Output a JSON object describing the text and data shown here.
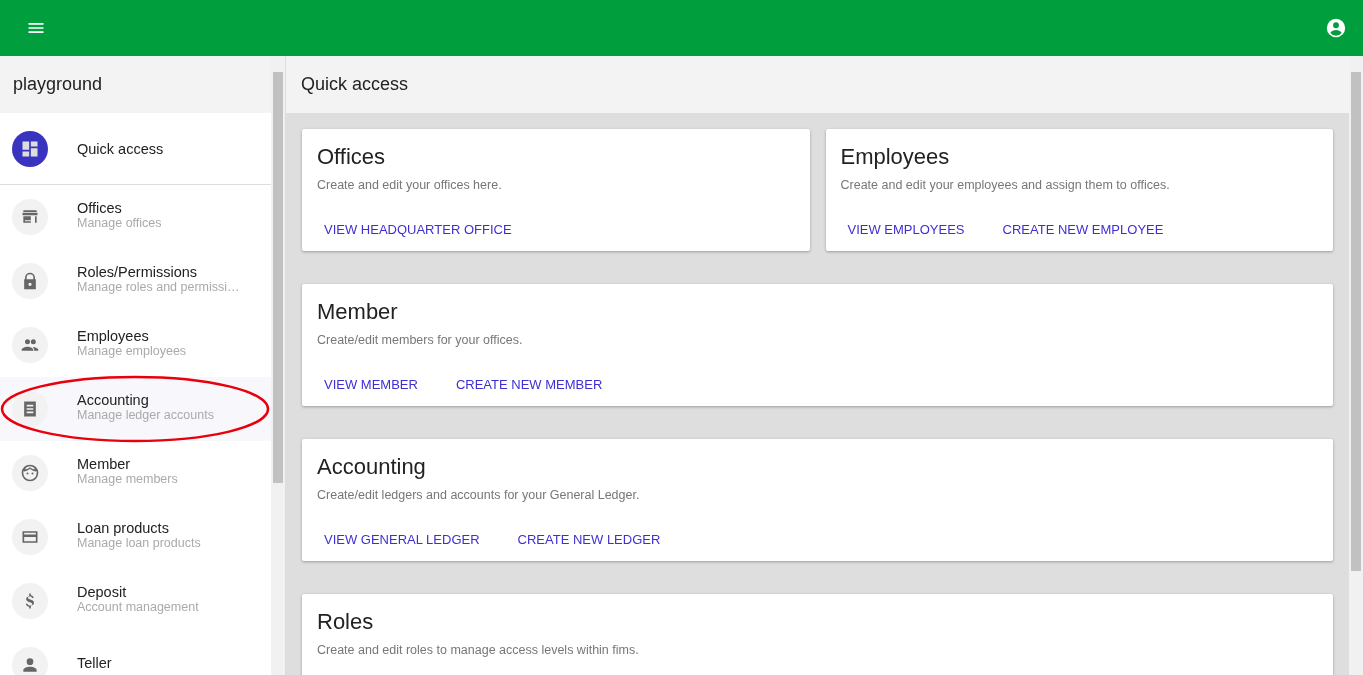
{
  "sidebar": {
    "title": "playground",
    "items": [
      {
        "kind": "primary",
        "label": "Quick access",
        "highlighted": false,
        "circled": false
      },
      {
        "kind": "entry",
        "label": "Offices",
        "sublabel": "Manage offices",
        "highlighted": false,
        "circled": false
      },
      {
        "kind": "entry",
        "label": "Roles/Permissions",
        "sublabel": "Manage roles and permissi…",
        "highlighted": false,
        "circled": false
      },
      {
        "kind": "entry",
        "label": "Employees",
        "sublabel": "Manage employees",
        "highlighted": false,
        "circled": false
      },
      {
        "kind": "entry",
        "label": "Accounting",
        "sublabel": "Manage ledger accounts",
        "highlighted": true,
        "circled": true
      },
      {
        "kind": "entry",
        "label": "Member",
        "sublabel": "Manage members",
        "highlighted": false,
        "circled": false
      },
      {
        "kind": "entry",
        "label": "Loan products",
        "sublabel": "Manage loan products",
        "highlighted": false,
        "circled": false
      },
      {
        "kind": "entry",
        "label": "Deposit",
        "sublabel": "Account management",
        "highlighted": false,
        "circled": false
      },
      {
        "kind": "entry",
        "label": "Teller",
        "highlighted": false,
        "circled": false
      }
    ]
  },
  "main": {
    "title": "Quick access",
    "rows": [
      [
        {
          "title": "Offices",
          "text": "Create and edit your offices here.",
          "actions": [
            "VIEW HEADQUARTER OFFICE"
          ]
        },
        {
          "title": "Employees",
          "text": "Create and edit your employees and assign them to offices.",
          "actions": [
            "VIEW EMPLOYEES",
            "CREATE NEW EMPLOYEE"
          ]
        }
      ],
      [
        {
          "title": "Member",
          "text": "Create/edit members for your offices.",
          "actions": [
            "VIEW MEMBER",
            "CREATE NEW MEMBER"
          ]
        }
      ],
      [
        {
          "title": "Accounting",
          "text": "Create/edit ledgers and accounts for your General Ledger.",
          "actions": [
            "VIEW GENERAL LEDGER",
            "CREATE NEW LEDGER"
          ]
        }
      ],
      [
        {
          "title": "Roles",
          "text": "Create and edit roles to manage access levels within fims."
        }
      ]
    ]
  }
}
